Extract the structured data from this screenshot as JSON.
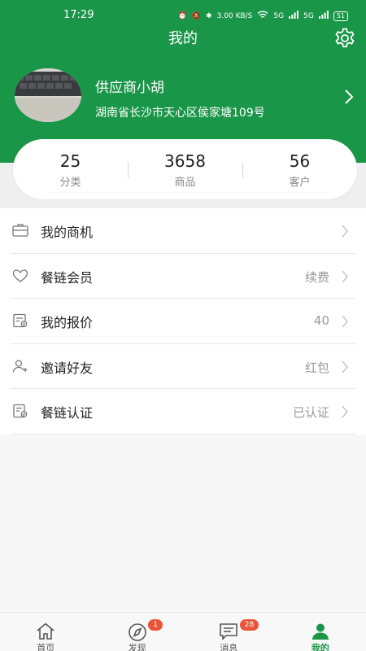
{
  "status_bar": {
    "time": "17:29",
    "net_speed": "3.00 KB/S",
    "signal1": "5G",
    "signal2": "5G",
    "battery": "51"
  },
  "nav": {
    "title": "我的"
  },
  "profile": {
    "name": "供应商小胡",
    "address": "湖南省长沙市天心区侯家塘109号"
  },
  "stats": [
    {
      "value": "25",
      "label": "分类"
    },
    {
      "value": "3658",
      "label": "商品"
    },
    {
      "value": "56",
      "label": "客户"
    }
  ],
  "menu": [
    {
      "label": "我的商机",
      "value": "",
      "icon": "briefcase-icon"
    },
    {
      "label": "餐链会员",
      "value": "续费",
      "icon": "heart-icon"
    },
    {
      "label": "我的报价",
      "value": "40",
      "icon": "quote-icon"
    },
    {
      "label": "邀请好友",
      "value": "红包",
      "icon": "add-user-icon"
    },
    {
      "label": "餐链认证",
      "value": "已认证",
      "icon": "certify-icon"
    }
  ],
  "tabs": [
    {
      "label": "首页",
      "badge": "",
      "icon": "home-icon"
    },
    {
      "label": "发现",
      "badge": "1",
      "icon": "compass-icon"
    },
    {
      "label": "消息",
      "badge": "28",
      "icon": "message-icon"
    },
    {
      "label": "我的",
      "badge": "",
      "icon": "person-icon"
    }
  ],
  "colors": {
    "brand": "#1a9648",
    "badge": "#e8553a"
  }
}
